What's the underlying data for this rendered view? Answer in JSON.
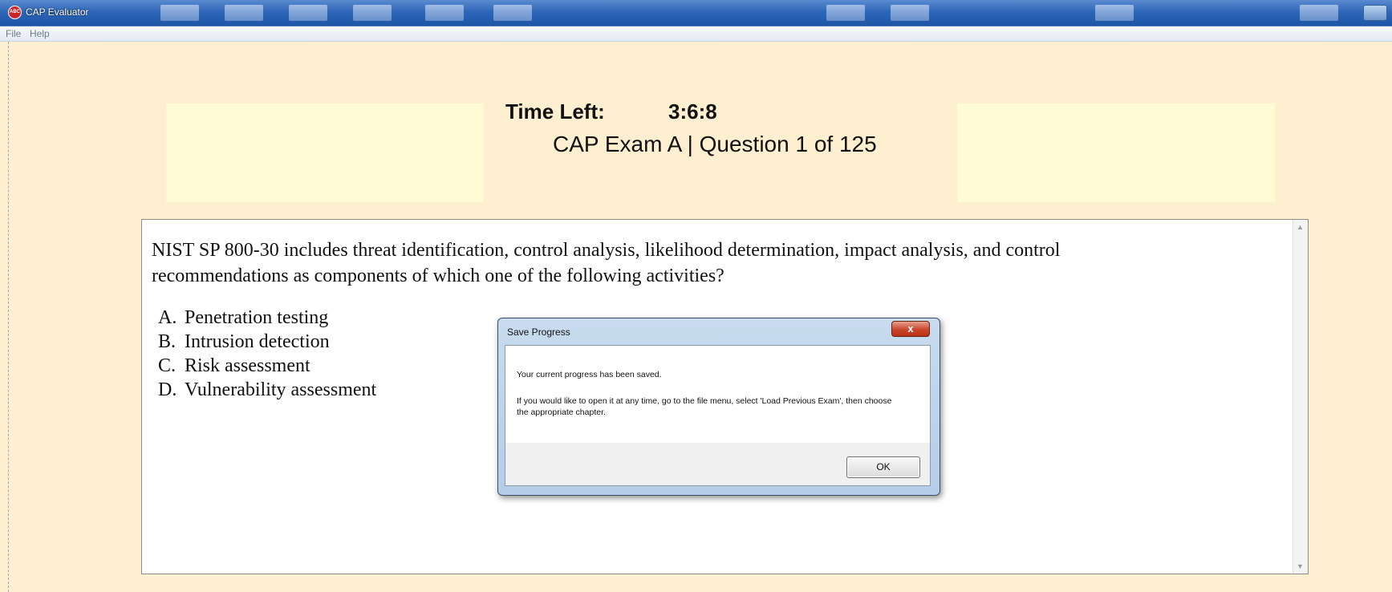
{
  "window": {
    "title": "CAP Evaluator",
    "app_icon_text": "ABC"
  },
  "menu": {
    "items": [
      "File",
      "Help"
    ]
  },
  "header": {
    "time_label": "Time Left:",
    "time_value": "3:6:8",
    "exam_title": "CAP Exam A | Question 1 of 125"
  },
  "question": {
    "text": "NIST SP 800-30 includes threat identification, control analysis, likelihood determination, impact analysis, and control recommendations as components of which one of the following activities?",
    "options": [
      {
        "letter": "A.",
        "text": "Penetration testing"
      },
      {
        "letter": "B.",
        "text": "Intrusion detection"
      },
      {
        "letter": "C.",
        "text": "Risk assessment"
      },
      {
        "letter": "D.",
        "text": "Vulnerability assessment"
      }
    ]
  },
  "dialog": {
    "title": "Save Progress",
    "close_label": "x",
    "message_line1": "Your current progress has been saved.",
    "message_line2": "If you would like to open it at any time, go to the file menu, select 'Load Previous Exam', then choose the appropriate chapter.",
    "ok_label": "OK"
  },
  "colors": {
    "background": "#fdefcf",
    "highlight_box": "#fffbd4",
    "titlebar": "#2f67b8",
    "close_button": "#c9452b"
  }
}
